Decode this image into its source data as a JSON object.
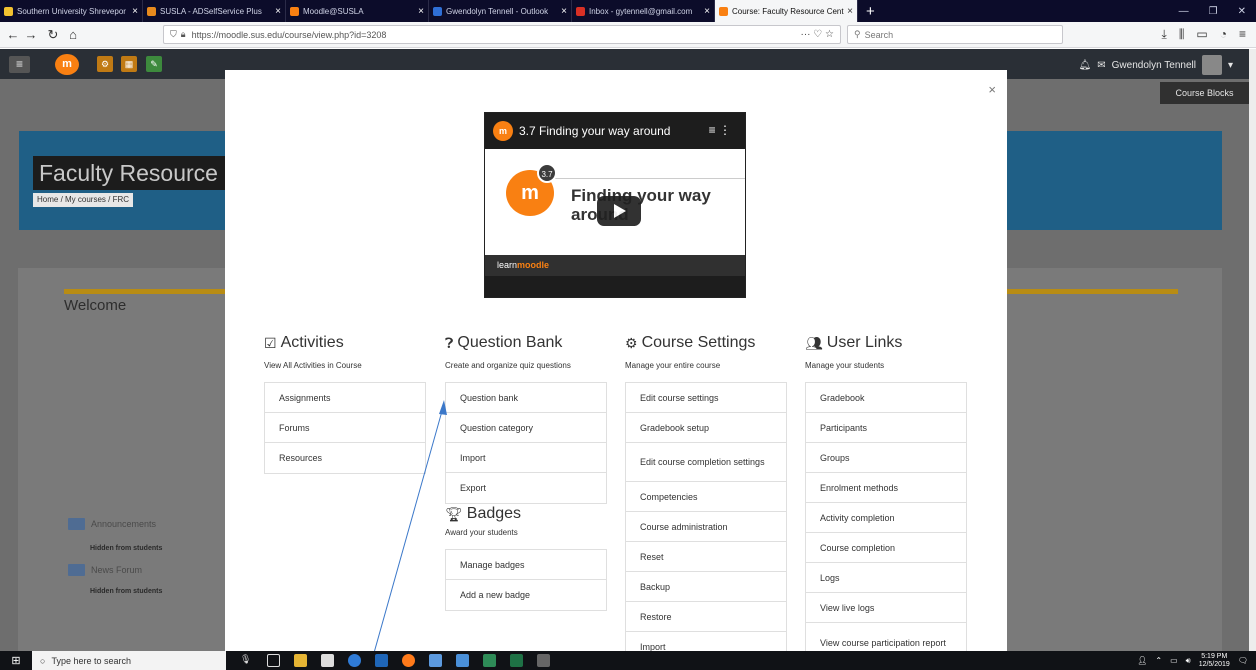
{
  "browser": {
    "tabs": [
      {
        "title": "Southern University Shrevepor",
        "favicon_color": "#f2c230",
        "active": false
      },
      {
        "title": "SUSLA - ADSelfService Plus",
        "favicon_color": "#e88a1d",
        "active": false
      },
      {
        "title": "Moodle@SUSLA",
        "favicon_color": "#f98012",
        "active": false
      },
      {
        "title": "Gwendolyn Tennell - Outlook",
        "favicon_color": "#2f6fd6",
        "active": false
      },
      {
        "title": "Inbox - gytennell@gmail.com",
        "favicon_color": "#d93025",
        "active": false
      },
      {
        "title": "Course: Faculty Resource Cent",
        "favicon_color": "#f98012",
        "active": true
      }
    ],
    "new_tab": "+",
    "url": "https://moodle.sus.edu/course/view.php?id=3208",
    "page_actions": "··· ♡ ☆",
    "search_placeholder": "Search"
  },
  "moodle": {
    "user_name": "Gwendolyn Tennell",
    "course_blocks_label": "Course Blocks",
    "course_title": "Faculty Resource C",
    "breadcrumb": "Home / My courses / FRC",
    "welcome": "Welcome",
    "forums": [
      {
        "name": "Announcements",
        "status": "Hidden from students"
      },
      {
        "name": "News Forum",
        "status": "Hidden from students"
      }
    ]
  },
  "modal": {
    "close": "×",
    "video": {
      "title": "3.7 Finding your way around",
      "headline": "Finding your way around",
      "version_badge": "3.7",
      "footer_learn": "learn",
      "footer_moodle": "moodle"
    },
    "columns": [
      {
        "title": "Activities",
        "subtitle": "View All Activities in Course",
        "items": [
          "Assignments",
          "Forums",
          "Resources"
        ]
      },
      {
        "title": "Question Bank",
        "subtitle": "Create and organize quiz questions",
        "items": [
          "Question bank",
          "Question category",
          "Import",
          "Export"
        ]
      },
      {
        "title": "Course Settings",
        "subtitle": "Manage your entire course",
        "items": [
          "Edit course settings",
          "Gradebook setup",
          "Edit course completion settings",
          "Competencies",
          "Course administration",
          "Reset",
          "Backup",
          "Restore",
          "Import"
        ]
      },
      {
        "title": "User Links",
        "subtitle": "Manage your students",
        "items": [
          "Gradebook",
          "Participants",
          "Groups",
          "Enrolment methods",
          "Activity completion",
          "Course completion",
          "Logs",
          "View live logs",
          "View course participation report"
        ]
      }
    ],
    "badges": {
      "title": "Badges",
      "subtitle": "Award your students",
      "items": [
        "Manage badges",
        "Add a new badge"
      ]
    }
  },
  "taskbar": {
    "search_placeholder": "Type here to search",
    "time": "5:19 PM",
    "date": "12/5/2019"
  },
  "colors": {
    "accent": "#1f5f86",
    "moodle_orange": "#f98012",
    "arrow": "#3b78c9"
  }
}
